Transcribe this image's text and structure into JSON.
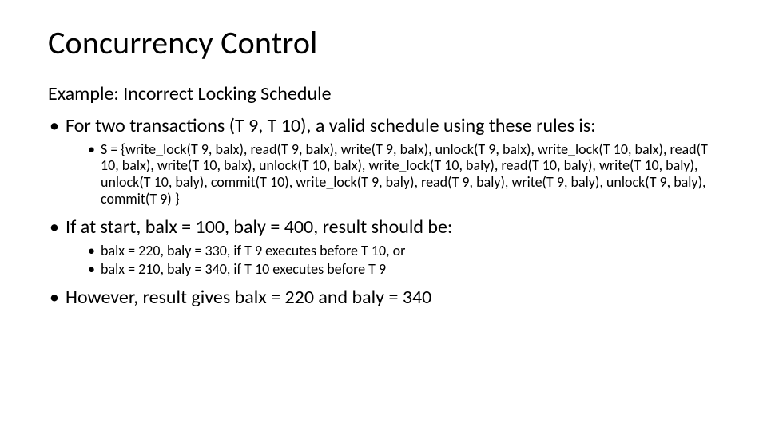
{
  "title": "Concurrency Control",
  "subtitle": "Example: Incorrect Locking Schedule",
  "bullets": {
    "b1": "For two transactions (T 9, T 10), a valid schedule using these rules is:",
    "b1_sub": "S = {write_lock(T 9, balx), read(T 9, balx), write(T 9, balx), unlock(T 9, balx), write_lock(T 10, balx), read(T 10, balx), write(T 10, balx), unlock(T 10, balx), write_lock(T 10, baly), read(T 10, baly), write(T 10, baly), unlock(T 10, baly), commit(T 10), write_lock(T 9, baly), read(T 9, baly), write(T 9, baly), unlock(T 9, baly), commit(T 9) }",
    "b2": "If at start, balx = 100, baly = 400, result should be:",
    "b2_sub1": "balx = 220, baly = 330, if T 9 executes before T 10, or",
    "b2_sub2": "balx = 210, baly = 340, if T 10 executes before T 9",
    "b3": "However, result gives balx = 220 and baly = 340"
  }
}
